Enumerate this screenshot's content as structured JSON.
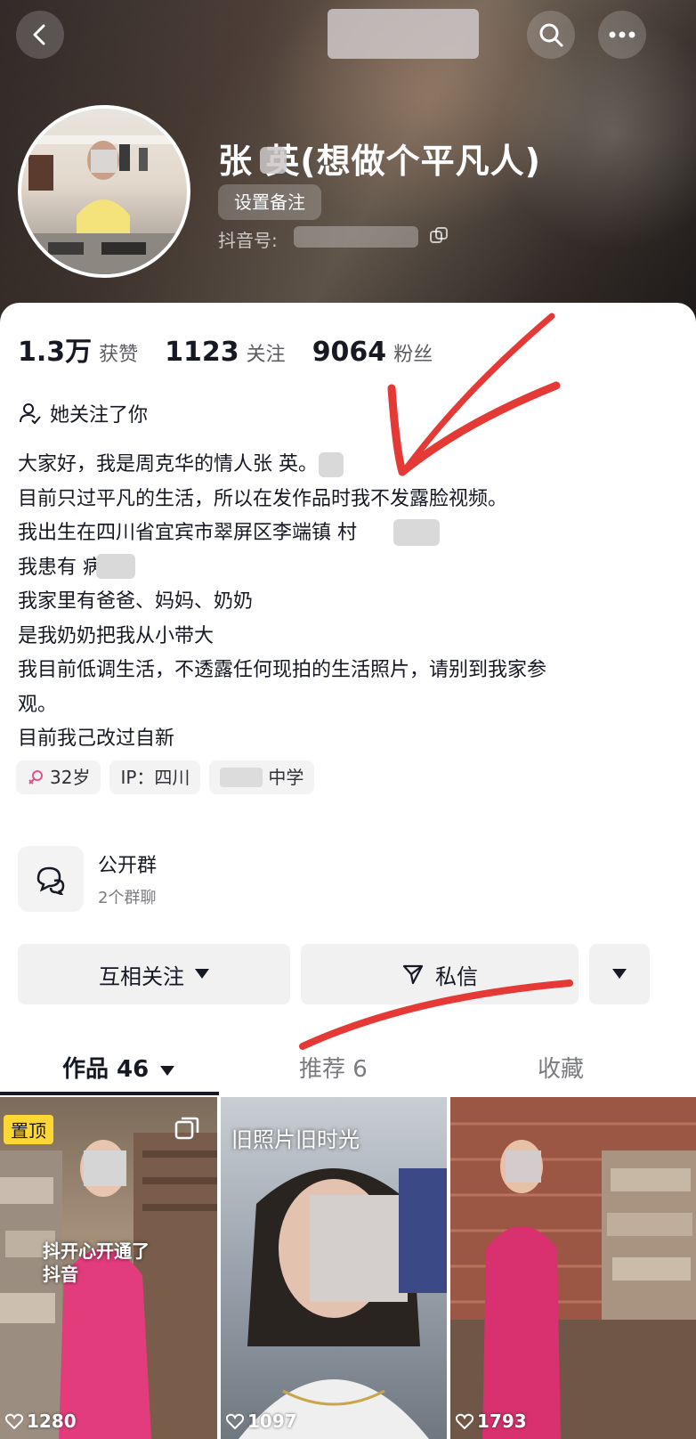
{
  "header": {
    "nickname": "张 英(想做个平凡人)",
    "remark_button": "设置备注",
    "douyin_id_label": "抖音号:",
    "icons": [
      "back-arrow-icon",
      "search-icon",
      "more-icon",
      "copy-icon"
    ]
  },
  "stats": [
    {
      "value": "1.3万",
      "label": "获赞"
    },
    {
      "value": "1123",
      "label": "关注"
    },
    {
      "value": "9064",
      "label": "粉丝"
    }
  ],
  "follow_status": "她关注了你",
  "bio": [
    "大家好，我是周克华的情人张 英。",
    "目前只过平凡的生活，所以在发作品时我不发露脸视频。",
    "我出生在四川省宜宾市翠屏区李端镇 村",
    "我患有 病",
    "我家里有爸爸、妈妈、奶奶",
    "是我奶奶把我从小带大",
    "我目前低调生活，不透露任何现拍的生活照片，请别到我家参",
    "观。",
    "目前我己改过自新"
  ],
  "tags": {
    "age": "32岁",
    "ip": "IP：四川",
    "school": "中学"
  },
  "group": {
    "title": "公开群",
    "subtitle": "2个群聊"
  },
  "buttons": {
    "mutual_follow": "互相关注",
    "message": "私信"
  },
  "tabs": [
    {
      "label": "作品 46",
      "active": true
    },
    {
      "label": "推荐 6",
      "active": false
    },
    {
      "label": "收藏",
      "active": false
    }
  ],
  "videos": [
    {
      "pinned_label": "置顶",
      "overlay": [
        "抖开心开通了",
        "抖音"
      ],
      "likes": "1280"
    },
    {
      "caption": "旧照片旧时光",
      "likes": "1097"
    },
    {
      "likes": "1793"
    }
  ],
  "colors": {
    "annotation_red": "#e53935",
    "pin_yellow": "#fdd835",
    "female_icon": "#e0528c"
  }
}
